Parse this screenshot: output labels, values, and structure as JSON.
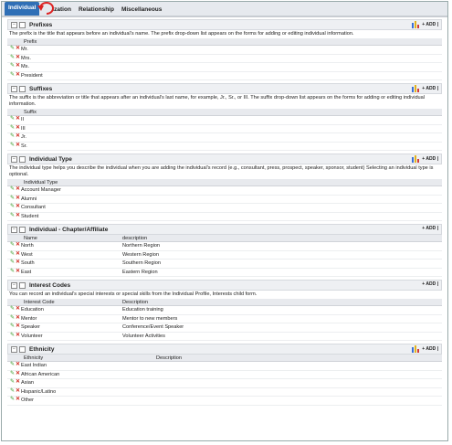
{
  "tabs": [
    {
      "label": "Individual",
      "active": true
    },
    {
      "label": "ization",
      "active": false
    },
    {
      "label": "Relationship",
      "active": false
    },
    {
      "label": "Miscellaneous",
      "active": false
    }
  ],
  "add_label": "+ ADD |",
  "sections": [
    {
      "title": "Prefixes",
      "desc": "The prefix is the title that appears before an individual's name. The prefix drop-down list appears on the forms for adding or editing individual information.",
      "columns": [
        "Prefix"
      ],
      "rows": [
        [
          "Mr."
        ],
        [
          "Mrs."
        ],
        [
          "Ms."
        ],
        [
          "President"
        ]
      ],
      "chart_icon": true
    },
    {
      "title": "Suffixes",
      "desc": "The suffix is the abbreviation or title that appears after an individual's last name, for example, Jr., Sr., or III. The suffix drop-down list appears on the forms for adding or editing individual information.",
      "columns": [
        "Suffix"
      ],
      "rows": [
        [
          "II"
        ],
        [
          "III"
        ],
        [
          "Jr."
        ],
        [
          "Sr."
        ]
      ],
      "chart_icon": true
    },
    {
      "title": "Individual Type",
      "desc": "The individual type helps you describe the individual when you are adding the individual's record (e.g., consultant, press, prospect, speaker, sponsor, student) Selecting an individual type is optional.",
      "columns": [
        "Individual Type"
      ],
      "rows": [
        [
          "Account Manager"
        ],
        [
          "Alumni"
        ],
        [
          "Consultant"
        ],
        [
          "Student"
        ]
      ],
      "chart_icon": true
    },
    {
      "title": "Individual - Chapter/Affiliate",
      "desc": "",
      "columns": [
        "Name",
        "description"
      ],
      "rows": [
        [
          "North",
          "Northern Region"
        ],
        [
          "West",
          "Western Region"
        ],
        [
          "South",
          "Southern Region"
        ],
        [
          "East",
          "Eastern Region"
        ]
      ],
      "chart_icon": false
    },
    {
      "title": "Interest Codes",
      "desc": "You can record an individual's special interests or special skills from the Individual Profile, Interests child form.",
      "columns": [
        "Interest Code",
        "Description"
      ],
      "rows": [
        [
          "Education",
          "Education training"
        ],
        [
          "Mentor",
          "Mentor to new members"
        ],
        [
          "Speaker",
          "Conference/Event Speaker"
        ],
        [
          "Volunteer",
          "Volunteer Activities"
        ]
      ],
      "chart_icon": false
    },
    {
      "title": "Ethnicity",
      "desc": "",
      "columns": [
        "Ethnicity",
        "Description"
      ],
      "rows": [
        [
          "East Indian",
          ""
        ],
        [
          "African American",
          ""
        ],
        [
          "Asian",
          ""
        ],
        [
          "Hispanic/Latino",
          ""
        ],
        [
          "Other",
          ""
        ]
      ],
      "chart_icon": true
    }
  ]
}
